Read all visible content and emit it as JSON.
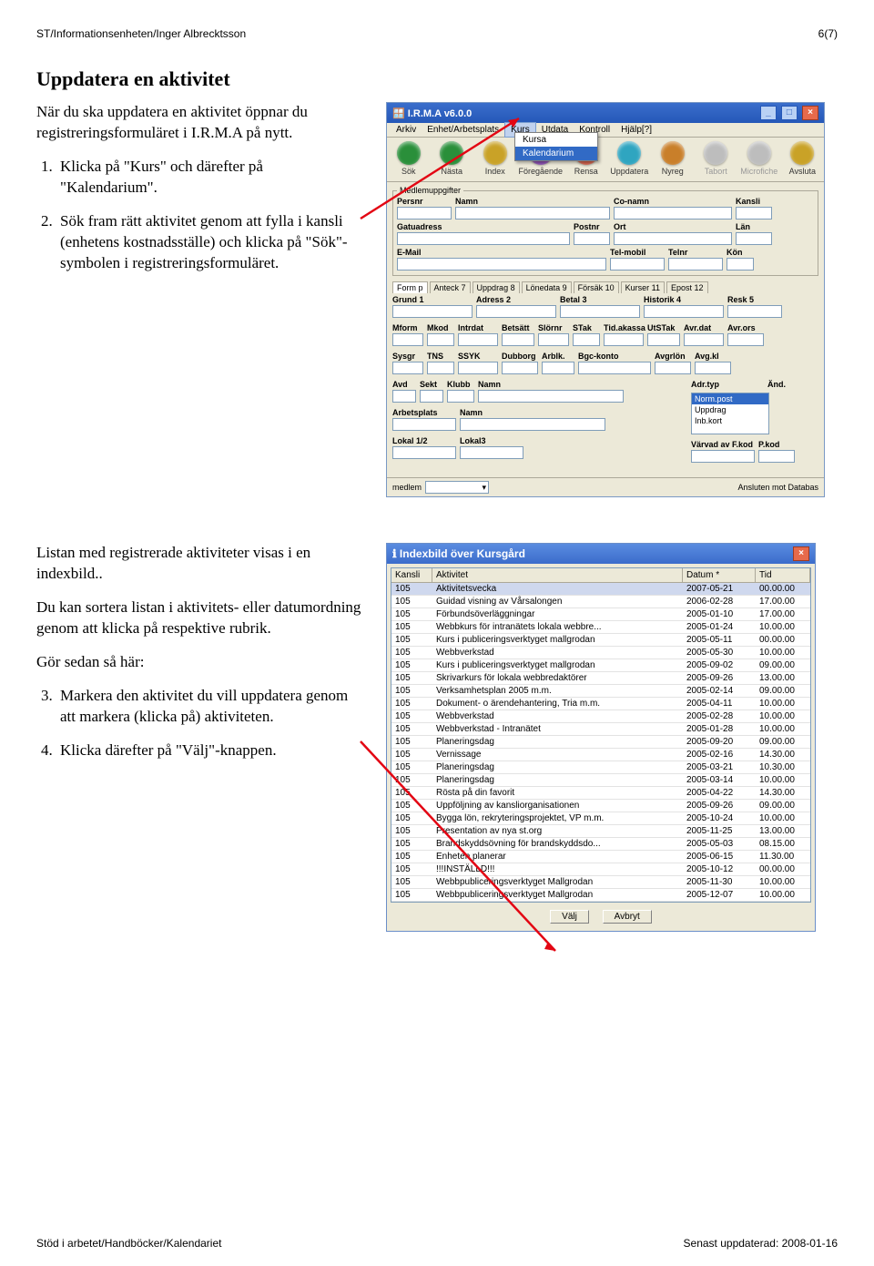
{
  "header": {
    "left": "ST/Informationsenheten/Inger Albrecktsson",
    "right": "6(7)"
  },
  "title": "Uppdatera en aktivitet",
  "intro": "När du ska uppdatera en aktivitet öppnar du registreringsformuläret i I.R.M.A på nytt.",
  "step1": "Klicka på \"Kurs\" och därefter på \"Kalendarium\".",
  "step2": "Sök fram rätt aktivitet genom att fylla i kansli (enhetens kostnadsställe) och klicka på \"Sök\"-symbolen i registreringsformuläret.",
  "intro2a": "Listan med registrerade aktiviteter visas i en indexbild..",
  "intro2b": "Du kan sortera listan i aktivitets- eller datumordning genom att klicka på respektive rubrik.",
  "intro2c": "Gör sedan så här:",
  "step3": "Markera den aktivitet du vill uppdatera genom att markera (klicka på) aktiviteten.",
  "step4": "Klicka därefter på \"Välj\"-knappen.",
  "footer": {
    "left": "Stöd i arbetet/Handböcker/Kalendariet",
    "right": "Senast uppdaterad: 2008-01-16"
  },
  "app": {
    "title": "I.R.M.A v6.0.0",
    "menus": [
      "Arkiv",
      "Enhet/Arbetsplats",
      "Kurs",
      "Utdata",
      "Kontroll",
      "Hjälp[?]"
    ],
    "dropdown": [
      "Kursa",
      "Kalendarium"
    ],
    "toolbarItems": [
      {
        "label": "Sök",
        "color": "#2a8f3a"
      },
      {
        "label": "Nästa",
        "color": "#2a8f3a"
      },
      {
        "label": "Index",
        "color": "#c9a227"
      },
      {
        "label": "Föregående",
        "color": "#8a4fb0"
      },
      {
        "label": "Rensa",
        "color": "#d0604a"
      },
      {
        "label": "Uppdatera",
        "color": "#2fa5c0"
      },
      {
        "label": "Nyreg",
        "color": "#c97f2a"
      },
      {
        "label": "Tabort",
        "color": "#bdbdbd",
        "disabled": true
      },
      {
        "label": "Microfiche",
        "color": "#bdbdbd",
        "disabled": true
      },
      {
        "label": "Avsluta",
        "color": "#c9a227"
      }
    ],
    "fields": {
      "group1": "Medlemuppgifter",
      "r1": [
        [
          "Persnr",
          60
        ],
        [
          "Namn",
          170
        ],
        [
          "Co-namn",
          130
        ],
        [
          "Kansli",
          40
        ]
      ],
      "r2": [
        [
          "Gatuadress",
          190
        ],
        [
          "Postnr",
          40
        ],
        [
          "Ort",
          130
        ],
        [
          "Län",
          40
        ]
      ],
      "r3": [
        [
          "E-Mail",
          230
        ],
        [
          "Tel-mobil",
          60
        ],
        [
          "Telnr",
          60
        ],
        [
          "Kön",
          30
        ]
      ],
      "tabs": [
        "Form p",
        "Anteck 7",
        "Uppdrag 8",
        "Lönedata 9",
        "Försäk 10",
        "Kurser 11",
        "Epost 12"
      ],
      "r4": [
        [
          "Grund 1",
          88
        ],
        [
          "Adress 2",
          88
        ],
        [
          "Betal 3",
          88
        ],
        [
          "Historik 4",
          88
        ],
        [
          "Resk 5",
          60
        ]
      ],
      "r5": [
        [
          "Mform",
          34
        ],
        [
          "Mkod",
          30
        ],
        [
          "Intrdat",
          44
        ],
        [
          "Betsätt",
          36
        ],
        [
          "Slörnr",
          34
        ],
        [
          "STak",
          30
        ],
        [
          "Tid.akassa",
          44
        ],
        [
          "UtSTak",
          36
        ],
        [
          "Avr.dat",
          44
        ],
        [
          "Avr.ors",
          40
        ]
      ],
      "r6": [
        [
          "Sysgr",
          34
        ],
        [
          "TNS",
          30
        ],
        [
          "SSYK",
          44
        ],
        [
          "Dubborg",
          40
        ],
        [
          "Arblk.",
          36
        ],
        [
          "Bgc-konto",
          80
        ],
        [
          "Avgrlön",
          40
        ],
        [
          "Avg.kl",
          40
        ]
      ],
      "r7": [
        [
          "Avd",
          26
        ],
        [
          "Sekt",
          26
        ],
        [
          "Klubb",
          30
        ],
        [
          "Namn",
          160
        ]
      ],
      "listbox_label": "Adr.typ",
      "listbox_and": "Änd.",
      "listbox": [
        "Norm.post",
        "Uppdrag",
        "Inb.kort"
      ],
      "r8": [
        [
          "Arbetsplats",
          70
        ],
        [
          "Namn",
          160
        ]
      ],
      "r9a": [
        [
          "Lokal 1/2",
          70
        ],
        [
          "Lokal3",
          70
        ]
      ],
      "r9b": [
        [
          "Värvad av F.kod",
          70
        ],
        [
          "P.kod",
          40
        ]
      ],
      "status_left": "medlem",
      "status_right": "Ansluten mot Databas"
    }
  },
  "index": {
    "title": "Indexbild över Kursgård",
    "headers": [
      "Kansli",
      "Aktivitet",
      "Datum *",
      "Tid"
    ],
    "rows": [
      [
        "105",
        "Aktivitetsvecka",
        "2007-05-21",
        "00.00.00"
      ],
      [
        "105",
        "Guidad visning av Vårsalongen",
        "2006-02-28",
        "17.00.00"
      ],
      [
        "105",
        "Förbunds­överläggningar",
        "2005-01-10",
        "17.00.00"
      ],
      [
        "105",
        "Webbkurs för intranätets lokala webbre...",
        "2005-01-24",
        "10.00.00"
      ],
      [
        "105",
        "Kurs i publiceringsverktyget mallgrodan",
        "2005-05-11",
        "00.00.00"
      ],
      [
        "105",
        "Webbverkstad",
        "2005-05-30",
        "10.00.00"
      ],
      [
        "105",
        "Kurs i publiceringsverktyget mallgrodan",
        "2005-09-02",
        "09.00.00"
      ],
      [
        "105",
        "Skrivarkurs för lokala webbredaktörer",
        "2005-09-26",
        "13.00.00"
      ],
      [
        "105",
        "Verksamhetsplan 2005 m.m.",
        "2005-02-14",
        "09.00.00"
      ],
      [
        "105",
        "Dokument- o ärendehantering, Tria m.m.",
        "2005-04-11",
        "10.00.00"
      ],
      [
        "105",
        "Webbverkstad",
        "2005-02-28",
        "10.00.00"
      ],
      [
        "105",
        "Webbverkstad - Intranätet",
        "2005-01-28",
        "10.00.00"
      ],
      [
        "105",
        "Planeringsdag",
        "2005-09-20",
        "09.00.00"
      ],
      [
        "105",
        "Vernissage",
        "2005-02-16",
        "14.30.00"
      ],
      [
        "105",
        "Planeringsdag",
        "2005-03-21",
        "10.30.00"
      ],
      [
        "105",
        "Planeringsdag",
        "2005-03-14",
        "10.00.00"
      ],
      [
        "105",
        "Rösta på din favorit",
        "2005-04-22",
        "14.30.00"
      ],
      [
        "105",
        "Uppföljning av kansliorganisationen",
        "2005-09-26",
        "09.00.00"
      ],
      [
        "105",
        "Bygga lön, rekryteringsprojektet, VP m.m.",
        "2005-10-24",
        "10.00.00"
      ],
      [
        "105",
        "Presentation av nya st.org",
        "2005-11-25",
        "13.00.00"
      ],
      [
        "105",
        "Brandskyddsövning för brandskyddsdo...",
        "2005-05-03",
        "08.15.00"
      ],
      [
        "105",
        "Enheten planerar",
        "2005-06-15",
        "11.30.00"
      ],
      [
        "105",
        "!!!INSTÄLLD!!!",
        "2005-10-12",
        "00.00.00"
      ],
      [
        "105",
        "Webbpubliceringsverktyget Mallgrodan",
        "2005-11-30",
        "10.00.00"
      ],
      [
        "105",
        "Webbpubliceringsverktyget Mallgrodan",
        "2005-12-07",
        "10.00.00"
      ]
    ],
    "btn_select": "Välj",
    "btn_cancel": "Avbryt"
  }
}
